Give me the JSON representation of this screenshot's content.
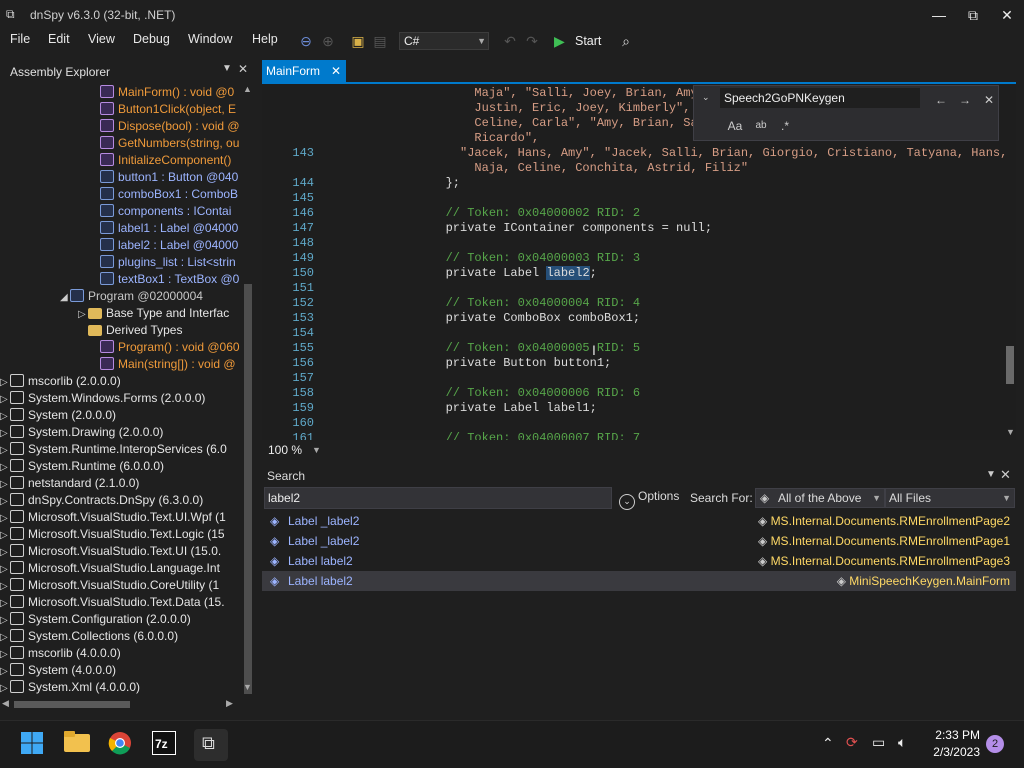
{
  "window": {
    "title": "dnSpy v6.3.0 (32-bit, .NET)"
  },
  "menu": [
    "File",
    "Edit",
    "View",
    "Debug",
    "Window",
    "Help"
  ],
  "toolbar": {
    "language": "C#",
    "start_label": "Start"
  },
  "assembly_explorer": {
    "title": "Assembly Explorer",
    "items": [
      {
        "text": "MainForm() : void @0",
        "kind": "meth",
        "indent": 100
      },
      {
        "text": "Button1Click(object, E",
        "kind": "meth",
        "indent": 100
      },
      {
        "text": "Dispose(bool) : void @",
        "kind": "meth",
        "indent": 100
      },
      {
        "text": "GetNumbers(string, ou",
        "kind": "meth",
        "indent": 100
      },
      {
        "text": "InitializeComponent()",
        "kind": "meth",
        "indent": 100
      },
      {
        "text": "button1 : Button @040",
        "kind": "fld",
        "indent": 100
      },
      {
        "text": "comboBox1 : ComboB",
        "kind": "fld",
        "indent": 100
      },
      {
        "text": "components : IContai",
        "kind": "fld",
        "indent": 100
      },
      {
        "text": "label1 : Label @04000",
        "kind": "fld",
        "indent": 100
      },
      {
        "text": "label2 : Label @04000",
        "kind": "fld",
        "indent": 100
      },
      {
        "text": "plugins_list : List<strin",
        "kind": "fld",
        "indent": 100
      },
      {
        "text": "textBox1 : TextBox @0",
        "kind": "fld",
        "indent": 100
      },
      {
        "text": "Program @02000004",
        "kind": "cls",
        "indent": 70
      },
      {
        "text": "Base Type and Interfac",
        "kind": "folder",
        "indent": 88
      },
      {
        "text": "Derived Types",
        "kind": "folder",
        "indent": 88
      },
      {
        "text": "Program() : void @060",
        "kind": "meth",
        "indent": 100
      },
      {
        "text": "Main(string[]) : void @",
        "kind": "meth",
        "indent": 100
      },
      {
        "text": "mscorlib (2.0.0.0)",
        "kind": "asm",
        "indent": 10
      },
      {
        "text": "System.Windows.Forms (2.0.0.0)",
        "kind": "asm",
        "indent": 10
      },
      {
        "text": "System (2.0.0.0)",
        "kind": "asm",
        "indent": 10
      },
      {
        "text": "System.Drawing (2.0.0.0)",
        "kind": "asm",
        "indent": 10
      },
      {
        "text": "System.Runtime.InteropServices (6.0",
        "kind": "asm",
        "indent": 10
      },
      {
        "text": "System.Runtime (6.0.0.0)",
        "kind": "asm",
        "indent": 10
      },
      {
        "text": "netstandard (2.1.0.0)",
        "kind": "asm",
        "indent": 10
      },
      {
        "text": "dnSpy.Contracts.DnSpy (6.3.0.0)",
        "kind": "asm",
        "indent": 10
      },
      {
        "text": "Microsoft.VisualStudio.Text.UI.Wpf (1",
        "kind": "asm",
        "indent": 10
      },
      {
        "text": "Microsoft.VisualStudio.Text.Logic (15",
        "kind": "asm",
        "indent": 10
      },
      {
        "text": "Microsoft.VisualStudio.Text.UI (15.0.",
        "kind": "asm",
        "indent": 10
      },
      {
        "text": "Microsoft.VisualStudio.Language.Int",
        "kind": "asm",
        "indent": 10
      },
      {
        "text": "Microsoft.VisualStudio.CoreUtility (1",
        "kind": "asm",
        "indent": 10
      },
      {
        "text": "Microsoft.VisualStudio.Text.Data (15.",
        "kind": "asm",
        "indent": 10
      },
      {
        "text": "System.Configuration (2.0.0.0)",
        "kind": "asm",
        "indent": 10
      },
      {
        "text": "System.Collections (6.0.0.0)",
        "kind": "asm",
        "indent": 10
      },
      {
        "text": "mscorlib (4.0.0.0)",
        "kind": "asm",
        "indent": 10
      },
      {
        "text": "System (4.0.0.0)",
        "kind": "asm",
        "indent": 10
      },
      {
        "text": "System.Xml (4.0.0.0)",
        "kind": "asm",
        "indent": 10
      }
    ]
  },
  "editor": {
    "tab": "MainForm",
    "zoom": "100 %",
    "lines": [
      {
        "n": "",
        "code": "            Maja\", \"Salli, Joey, Brian, Amy, Russe",
        "type": "str"
      },
      {
        "n": "",
        "code": "            Justin, Eric, Joey, Kimberly\", \"Amy, B",
        "type": "str"
      },
      {
        "n": "",
        "code": "            Celine, Carla\", \"Amy, Brian, Salli\", \"",
        "type": "str"
      },
      {
        "n": "",
        "code": "            Ricardo\",",
        "type": "str"
      },
      {
        "n": "143",
        "code": "          \"Jacek, Hans, Amy\", \"Jacek, Salli, Brian, Giorgio, Cristiano, Tatyana, Hans,",
        "type": "str"
      },
      {
        "n": "",
        "code": "            Naja, Celine, Conchita, Astrid, Filiz\"",
        "type": "str"
      },
      {
        "n": "144",
        "code": "        };",
        "type": "plain"
      },
      {
        "n": "145",
        "code": "",
        "type": "plain"
      },
      {
        "n": "146",
        "code": "        // Token: 0x04000002 RID: 2",
        "type": "com"
      },
      {
        "n": "147",
        "code": "        private IContainer components = null;",
        "type": "plain"
      },
      {
        "n": "148",
        "code": "",
        "type": "plain"
      },
      {
        "n": "149",
        "code": "        // Token: 0x04000003 RID: 3",
        "type": "com"
      },
      {
        "n": "150",
        "code": "        private Label label2;",
        "type": "hl"
      },
      {
        "n": "151",
        "code": "",
        "type": "plain"
      },
      {
        "n": "152",
        "code": "        // Token: 0x04000004 RID: 4",
        "type": "com"
      },
      {
        "n": "153",
        "code": "        private ComboBox comboBox1;",
        "type": "plain"
      },
      {
        "n": "154",
        "code": "",
        "type": "plain"
      },
      {
        "n": "155",
        "code": "        // Token: 0x04000005 RID: 5",
        "type": "com"
      },
      {
        "n": "156",
        "code": "        private Button button1;",
        "type": "plain"
      },
      {
        "n": "157",
        "code": "",
        "type": "plain"
      },
      {
        "n": "158",
        "code": "        // Token: 0x04000006 RID: 6",
        "type": "com"
      },
      {
        "n": "159",
        "code": "        private Label label1;",
        "type": "plain"
      },
      {
        "n": "160",
        "code": "",
        "type": "plain"
      },
      {
        "n": "161",
        "code": "        // Token: 0x04000007 RID: 7",
        "type": "com"
      }
    ]
  },
  "find": {
    "query": "Speech2GoPNKeygen"
  },
  "search": {
    "title": "Search",
    "query": "label2",
    "options_label": "Options",
    "search_for_label": "Search For:",
    "search_for_value": "All of the Above",
    "scope_value": "All Files",
    "results": [
      {
        "name": "Label _label2",
        "ns": "MS.Internal.Documents.",
        "cls": "RMEnrollmentPage2",
        "selected": false
      },
      {
        "name": "Label _label2",
        "ns": "MS.Internal.Documents.",
        "cls": "RMEnrollmentPage1",
        "selected": false
      },
      {
        "name": "Label label2",
        "ns": "MS.Internal.Documents.",
        "cls": "RMEnrollmentPage3",
        "selected": false
      },
      {
        "name": "Label label2",
        "ns": "MiniSpeechKeygen.",
        "cls": "MainForm",
        "selected": true
      }
    ]
  },
  "taskbar": {
    "time": "2:33 PM",
    "date": "2/3/2023",
    "notifications": "2"
  }
}
